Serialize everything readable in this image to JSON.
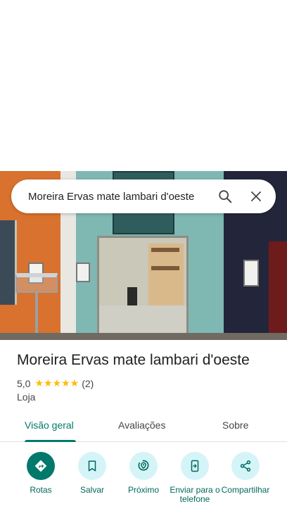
{
  "search": {
    "query": "Moreira Ervas mate lambari d'oeste"
  },
  "place": {
    "name": "Moreira Ervas mate lambari d'oeste",
    "rating": "5,0",
    "stars": "★★★★★",
    "review_count": "(2)",
    "category": "Loja"
  },
  "tabs": [
    {
      "label": "Visão geral",
      "active": true
    },
    {
      "label": "Avaliações",
      "active": false
    },
    {
      "label": "Sobre",
      "active": false
    }
  ],
  "actions": [
    {
      "label": "Rotas",
      "icon": "directions-icon"
    },
    {
      "label": "Salvar",
      "icon": "bookmark-icon"
    },
    {
      "label": "Próximo",
      "icon": "nearby-icon"
    },
    {
      "label": "Enviar para o telefone",
      "icon": "send-to-phone-icon"
    },
    {
      "label": "Compartilhar",
      "icon": "share-icon"
    }
  ],
  "colors": {
    "accent": "#00796b",
    "star": "#fbbc04",
    "action_bg": "#d4f4f8"
  }
}
